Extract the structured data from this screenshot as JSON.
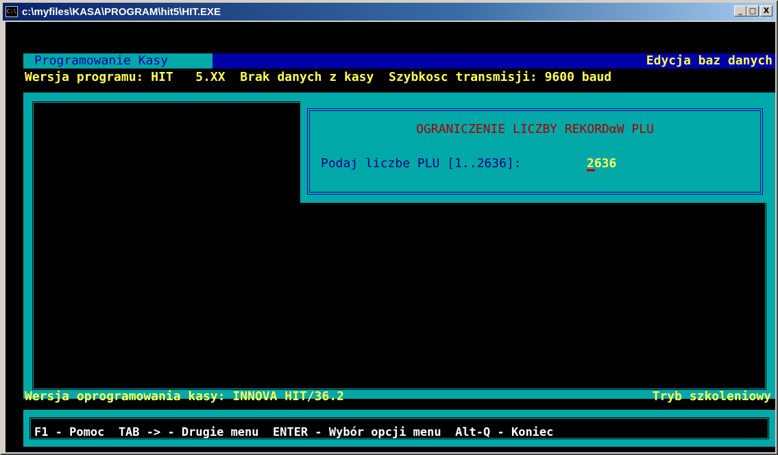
{
  "window": {
    "title": "c:\\myfiles\\KASA\\PROGRAM\\hit5\\HIT.EXE",
    "icon_text": "C:\\",
    "buttons": {
      "minimize": "_",
      "maximize": "□",
      "close": "X"
    }
  },
  "header": {
    "left": "Programowanie Kasy",
    "right": "Edycja baz danych"
  },
  "info": {
    "line": "Wersja programu: HIT   5.XX  Brak danych z kasy  Szybkosc transmisji: 9600 baud"
  },
  "dialog": {
    "title": "OGRANICZENIE LICZBY REKORDαW PLU",
    "prompt": "Podaj liczbe PLU [1..2636]:",
    "input_value": "2636"
  },
  "status": {
    "left": "Wersja oprogramowania kasy: INNOVA HIT/36.2",
    "right": "Tryb szkoleniowy"
  },
  "footer": {
    "text": "F1 - Pomoc  TAB -> - Drugie menu  ENTER - Wybór opcji menu  Alt-Q - Koniec"
  },
  "colors": {
    "console_bg": "#000000",
    "cyan": "#00a8a8",
    "blue": "#0000a8",
    "yellow": "#ffff54",
    "red": "#a80000"
  }
}
